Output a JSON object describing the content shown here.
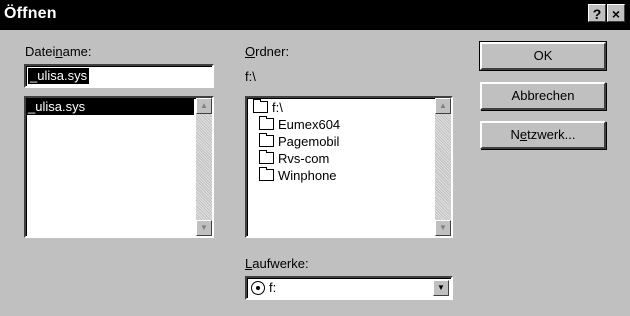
{
  "window": {
    "title": "Öffnen",
    "help": "?",
    "close": "×"
  },
  "filename": {
    "label_pre": "Datei",
    "label_ul": "n",
    "label_post": "ame:",
    "value": "_ulisa.sys",
    "list": [
      "_ulisa.sys"
    ]
  },
  "folders": {
    "label_ul": "O",
    "label_post": "rdner:",
    "current": "f:\\",
    "items": [
      "f:\\",
      "Eumex604",
      "Pagemobil",
      "Rvs-com",
      "Winphone"
    ]
  },
  "drives": {
    "label_ul": "L",
    "label_post": "aufwerke:",
    "value": "f:"
  },
  "buttons": {
    "ok": "OK",
    "cancel": "Abbrechen",
    "network_pre": "N",
    "network_ul": "e",
    "network_post": "tzwerk..."
  }
}
